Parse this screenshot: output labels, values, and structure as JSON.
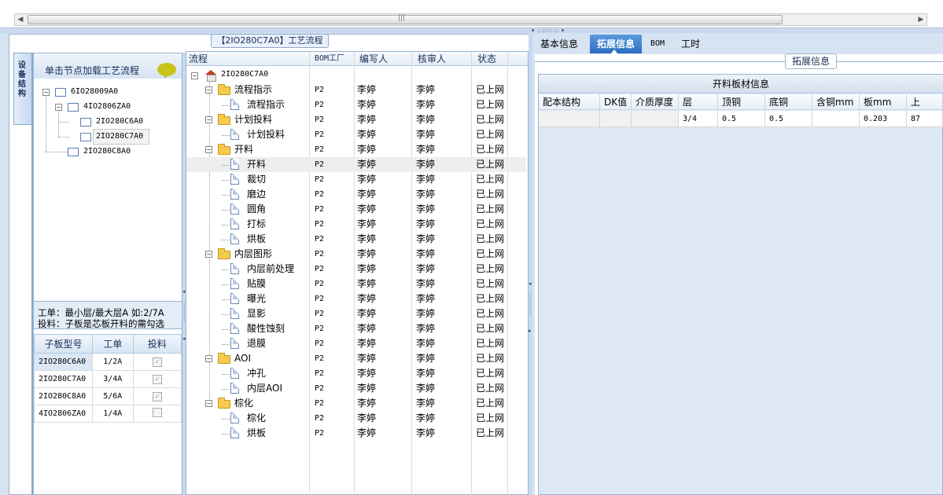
{
  "flow_panel": {
    "title": "【2IO280C7A0】工艺流程",
    "columns": {
      "flow": "流程",
      "bom_factory": "BOM工厂",
      "writer": "编写人",
      "reviewer": "核审人",
      "status": "状态"
    },
    "root": "2IO280C7A0",
    "rows": [
      {
        "name": "流程指示",
        "kind": "folder",
        "level": 1,
        "bom": "P2",
        "writer": "李婷",
        "reviewer": "李婷",
        "status": "已上网"
      },
      {
        "name": "流程指示",
        "kind": "doc",
        "level": 2,
        "bom": "P2",
        "writer": "李婷",
        "reviewer": "李婷",
        "status": "已上网"
      },
      {
        "name": "计划投料",
        "kind": "folder",
        "level": 1,
        "bom": "P2",
        "writer": "李婷",
        "reviewer": "李婷",
        "status": "已上网"
      },
      {
        "name": "计划投料",
        "kind": "doc",
        "level": 2,
        "bom": "P2",
        "writer": "李婷",
        "reviewer": "李婷",
        "status": "已上网"
      },
      {
        "name": "开料",
        "kind": "folder",
        "level": 1,
        "bom": "P2",
        "writer": "李婷",
        "reviewer": "李婷",
        "status": "已上网"
      },
      {
        "name": "开料",
        "kind": "doc",
        "level": 2,
        "bom": "P2",
        "writer": "李婷",
        "reviewer": "李婷",
        "status": "已上网",
        "highlight": true
      },
      {
        "name": "裁切",
        "kind": "doc",
        "level": 2,
        "bom": "P2",
        "writer": "李婷",
        "reviewer": "李婷",
        "status": "已上网"
      },
      {
        "name": "磨边",
        "kind": "doc",
        "level": 2,
        "bom": "P2",
        "writer": "李婷",
        "reviewer": "李婷",
        "status": "已上网"
      },
      {
        "name": "圆角",
        "kind": "doc",
        "level": 2,
        "bom": "P2",
        "writer": "李婷",
        "reviewer": "李婷",
        "status": "已上网"
      },
      {
        "name": "打标",
        "kind": "doc",
        "level": 2,
        "bom": "P2",
        "writer": "李婷",
        "reviewer": "李婷",
        "status": "已上网"
      },
      {
        "name": "烘板",
        "kind": "doc",
        "level": 2,
        "bom": "P2",
        "writer": "李婷",
        "reviewer": "李婷",
        "status": "已上网"
      },
      {
        "name": "内层图形",
        "kind": "folder",
        "level": 1,
        "bom": "P2",
        "writer": "李婷",
        "reviewer": "李婷",
        "status": "已上网"
      },
      {
        "name": "内层前处理",
        "kind": "doc",
        "level": 2,
        "bom": "P2",
        "writer": "李婷",
        "reviewer": "李婷",
        "status": "已上网"
      },
      {
        "name": "贴膜",
        "kind": "doc",
        "level": 2,
        "bom": "P2",
        "writer": "李婷",
        "reviewer": "李婷",
        "status": "已上网"
      },
      {
        "name": "曝光",
        "kind": "doc",
        "level": 2,
        "bom": "P2",
        "writer": "李婷",
        "reviewer": "李婷",
        "status": "已上网"
      },
      {
        "name": "显影",
        "kind": "doc",
        "level": 2,
        "bom": "P2",
        "writer": "李婷",
        "reviewer": "李婷",
        "status": "已上网"
      },
      {
        "name": "酸性蚀刻",
        "kind": "doc",
        "level": 2,
        "bom": "P2",
        "writer": "李婷",
        "reviewer": "李婷",
        "status": "已上网"
      },
      {
        "name": "退膜",
        "kind": "doc",
        "level": 2,
        "bom": "P2",
        "writer": "李婷",
        "reviewer": "李婷",
        "status": "已上网"
      },
      {
        "name": "AOI",
        "kind": "folder",
        "level": 1,
        "bom": "P2",
        "writer": "李婷",
        "reviewer": "李婷",
        "status": "已上网"
      },
      {
        "name": "冲孔",
        "kind": "doc",
        "level": 2,
        "bom": "P2",
        "writer": "李婷",
        "reviewer": "李婷",
        "status": "已上网"
      },
      {
        "name": "内层AOI",
        "kind": "doc",
        "level": 2,
        "bom": "P2",
        "writer": "李婷",
        "reviewer": "李婷",
        "status": "已上网"
      },
      {
        "name": "棕化",
        "kind": "folder",
        "level": 1,
        "bom": "P2",
        "writer": "李婷",
        "reviewer": "李婷",
        "status": "已上网"
      },
      {
        "name": "棕化",
        "kind": "doc",
        "level": 2,
        "bom": "P2",
        "writer": "李婷",
        "reviewer": "李婷",
        "status": "已上网"
      },
      {
        "name": "烘板",
        "kind": "doc",
        "level": 2,
        "bom": "P2",
        "writer": "李婷",
        "reviewer": "李婷",
        "status": "已上网"
      }
    ]
  },
  "left_panel": {
    "vertical_tab": "设备结构",
    "header_text": "单击节点加载工艺流程",
    "tree": [
      "6IO28009A0",
      "4IO2806ZA0",
      "2IO280C6A0",
      "2IO280C7A0",
      "2IO280C8A0"
    ],
    "info_line1": "工单：最小层/最大层A 如:2/7A",
    "info_line2": "投料：子板是芯板开料的需勾选",
    "table": {
      "headers": [
        "子板型号",
        "工单",
        "投料"
      ],
      "rows": [
        {
          "model": "2IO280C6A0",
          "order": "1/2A",
          "checked": true,
          "enabled": false
        },
        {
          "model": "2IO280C7A0",
          "order": "3/4A",
          "checked": true,
          "enabled": false
        },
        {
          "model": "2IO280C8A0",
          "order": "5/6A",
          "checked": true,
          "enabled": false
        },
        {
          "model": "4IO2806ZA0",
          "order": "1/4A",
          "checked": false,
          "enabled": false
        }
      ]
    }
  },
  "right_panel": {
    "tabs": [
      "基本信息",
      "拓展信息",
      "BOM",
      "工时"
    ],
    "active_tab": "拓展信息",
    "group_title": "拓展信息",
    "grid_caption": "开料板材信息",
    "grid_headers": [
      "配本结构",
      "DK值",
      "介质厚度",
      "层",
      "顶铜",
      "底铜",
      "含铜mm",
      "板mm",
      "上"
    ],
    "grid_rows": [
      [
        "",
        "",
        "",
        "3/4",
        "0.5",
        "0.5",
        "",
        "0.203",
        "87"
      ]
    ]
  },
  "colors": {
    "accent": "#2b6cc0",
    "panel_border": "#99b4d1",
    "background": "#d6e3f2"
  }
}
